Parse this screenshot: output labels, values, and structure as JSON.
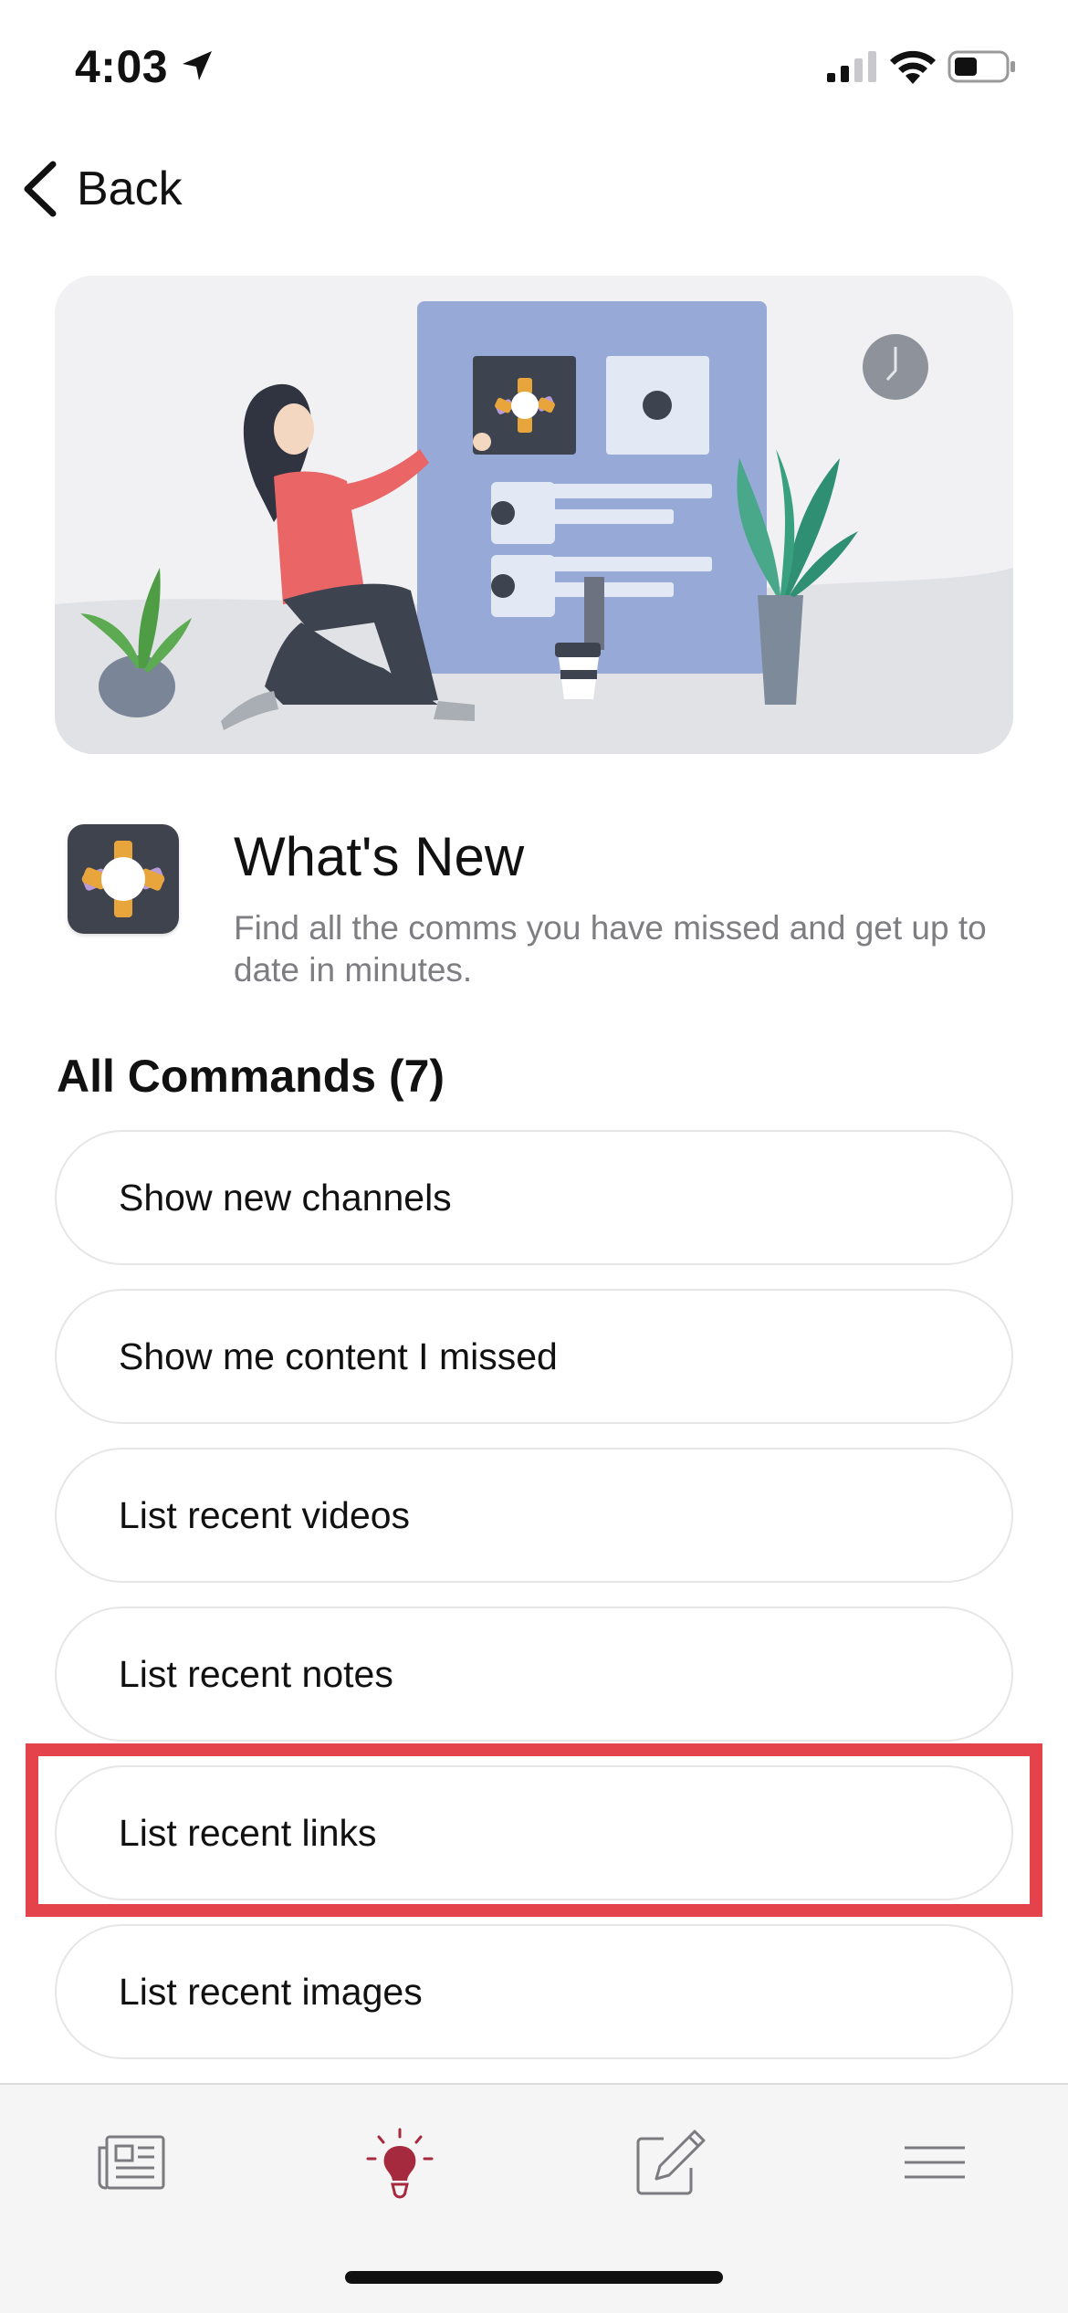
{
  "status_bar": {
    "time": "4:03"
  },
  "nav": {
    "back_label": "Back"
  },
  "app": {
    "title": "What's New",
    "description": "Find all the comms you have missed and get up to date in minutes."
  },
  "commands": {
    "heading": "All Commands (7)",
    "items": [
      {
        "label": "Show new channels"
      },
      {
        "label": "Show me content I missed"
      },
      {
        "label": "List recent videos"
      },
      {
        "label": "List recent notes"
      },
      {
        "label": "List recent links",
        "highlighted": true
      },
      {
        "label": "List recent images"
      }
    ]
  },
  "tab_bar": {
    "tabs": [
      {
        "icon": "newspaper-icon",
        "active": false
      },
      {
        "icon": "lightbulb-icon",
        "active": true
      },
      {
        "icon": "pencil-edit-icon",
        "active": false
      },
      {
        "icon": "menu-icon",
        "active": false
      }
    ],
    "active_color": "#a52a3e",
    "inactive_color": "#7b7b80"
  },
  "colors": {
    "highlight": "#e4434c",
    "hero_board": "#97a9d6"
  }
}
